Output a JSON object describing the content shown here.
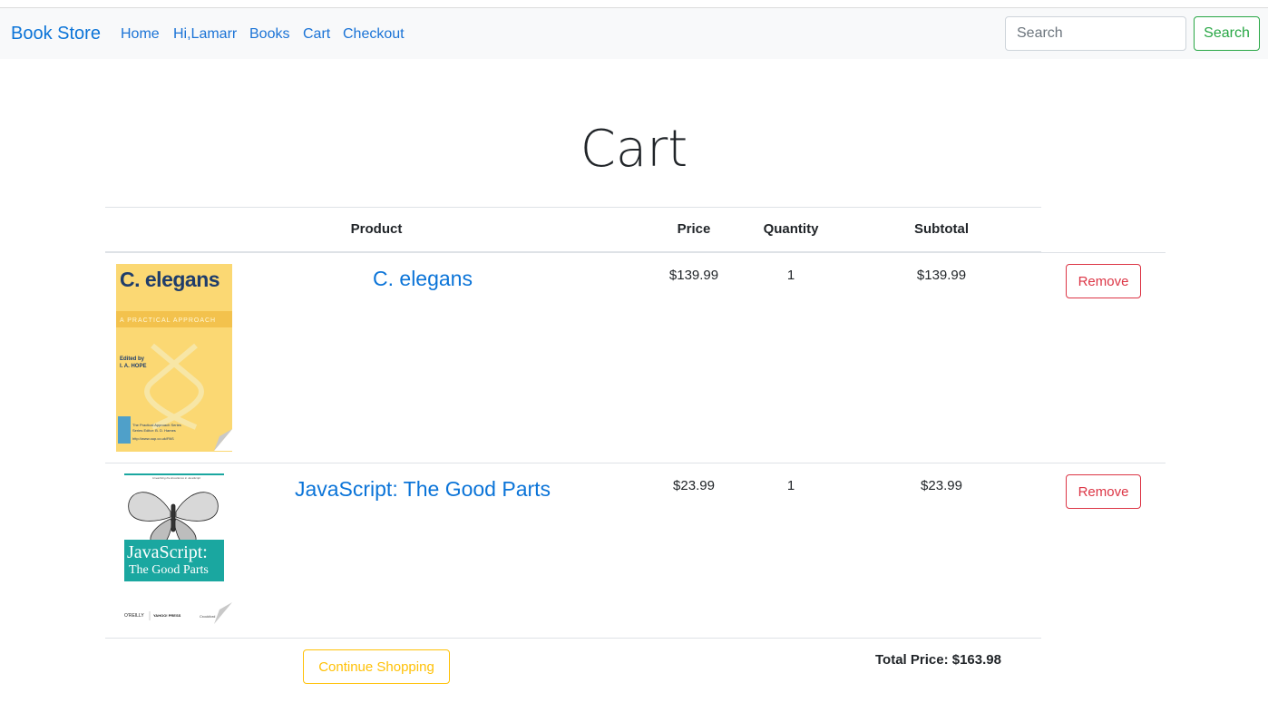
{
  "nav": {
    "brand": "Book Store",
    "links": [
      "Home",
      "Hi,Lamarr",
      "Books",
      "Cart",
      "Checkout"
    ],
    "search_placeholder": "Search",
    "search_button": "Search"
  },
  "page": {
    "title": "Cart"
  },
  "table": {
    "headers": {
      "product": "Product",
      "price": "Price",
      "quantity": "Quantity",
      "subtotal": "Subtotal"
    },
    "rows": [
      {
        "name": "C. elegans",
        "price": "$139.99",
        "quantity": "1",
        "subtotal": "$139.99",
        "remove": "Remove",
        "cover": {
          "title": "C. elegans",
          "subtitle": "A PRACTICAL APPROACH",
          "editor_label": "Edited by",
          "editor": "I. A. HOPE",
          "series": "The Practical Approach Series",
          "series_editor": "Series Editor: B. D. Hames",
          "url": "http://www.oup.co.uk/PAS",
          "bg_color": "#fbd873",
          "title_color": "#1f3d6b"
        }
      },
      {
        "name": "JavaScript: The Good Parts",
        "price": "$23.99",
        "quantity": "1",
        "subtotal": "$23.99",
        "remove": "Remove",
        "cover": {
          "tagline": "Unearthing the Excellence in JavaScript",
          "title_line1": "JavaScript:",
          "title_line2": "The Good Parts",
          "publisher": "O'REILLY",
          "copublisher": "YAHOO! PRESS",
          "author": "Crockford",
          "band_color": "#1aa7a0"
        }
      }
    ]
  },
  "footer": {
    "continue": "Continue Shopping",
    "total": "Total Price: $163.98"
  },
  "colors": {
    "link": "#0b74d8",
    "success": "#28a745",
    "danger": "#dc3545",
    "warning": "#ffc107"
  }
}
